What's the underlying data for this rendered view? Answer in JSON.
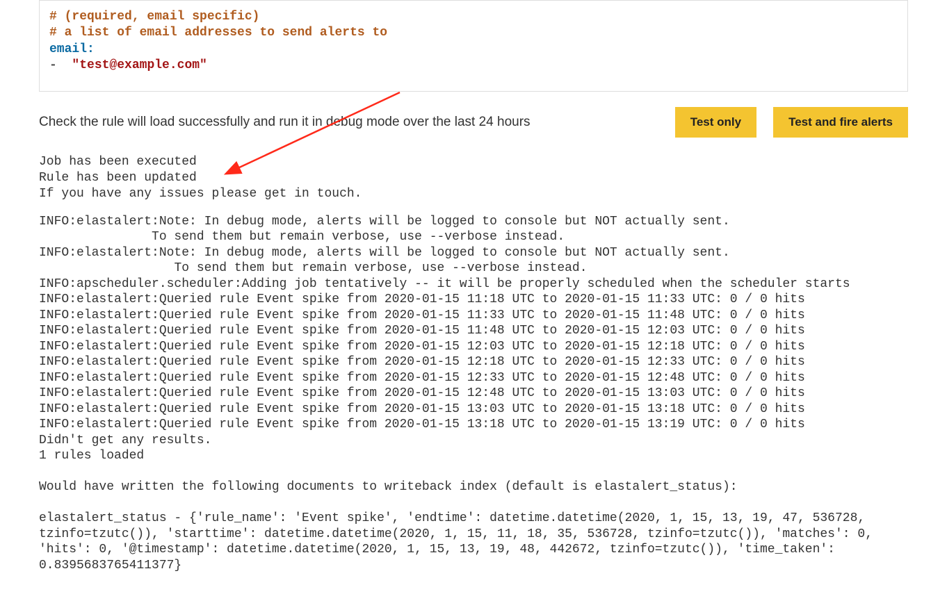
{
  "code": {
    "comment1": "# (required, email specific)",
    "comment2": "# a list of email addresses to send alerts to",
    "key": "email:",
    "dash": "-",
    "value": "\"test@example.com\""
  },
  "instruction": "Check the rule will load successfully and run it in debug mode over the last 24 hours",
  "buttons": {
    "test_only": "Test only",
    "test_fire": "Test and fire alerts"
  },
  "status": {
    "l1": "Job has been executed",
    "l2": "Rule has been updated",
    "l3": "If you have any issues please get in touch."
  },
  "log": "INFO:elastalert:Note: In debug mode, alerts will be logged to console but NOT actually sent.\n               To send them but remain verbose, use --verbose instead.\nINFO:elastalert:Note: In debug mode, alerts will be logged to console but NOT actually sent.\n                  To send them but remain verbose, use --verbose instead.\nINFO:apscheduler.scheduler:Adding job tentatively -- it will be properly scheduled when the scheduler starts\nINFO:elastalert:Queried rule Event spike from 2020-01-15 11:18 UTC to 2020-01-15 11:33 UTC: 0 / 0 hits\nINFO:elastalert:Queried rule Event spike from 2020-01-15 11:33 UTC to 2020-01-15 11:48 UTC: 0 / 0 hits\nINFO:elastalert:Queried rule Event spike from 2020-01-15 11:48 UTC to 2020-01-15 12:03 UTC: 0 / 0 hits\nINFO:elastalert:Queried rule Event spike from 2020-01-15 12:03 UTC to 2020-01-15 12:18 UTC: 0 / 0 hits\nINFO:elastalert:Queried rule Event spike from 2020-01-15 12:18 UTC to 2020-01-15 12:33 UTC: 0 / 0 hits\nINFO:elastalert:Queried rule Event spike from 2020-01-15 12:33 UTC to 2020-01-15 12:48 UTC: 0 / 0 hits\nINFO:elastalert:Queried rule Event spike from 2020-01-15 12:48 UTC to 2020-01-15 13:03 UTC: 0 / 0 hits\nINFO:elastalert:Queried rule Event spike from 2020-01-15 13:03 UTC to 2020-01-15 13:18 UTC: 0 / 0 hits\nINFO:elastalert:Queried rule Event spike from 2020-01-15 13:18 UTC to 2020-01-15 13:19 UTC: 0 / 0 hits\nDidn't get any results.\n1 rules loaded\n\nWould have written the following documents to writeback index (default is elastalert_status):\n\nelastalert_status - {'rule_name': 'Event spike', 'endtime': datetime.datetime(2020, 1, 15, 13, 19, 47, 536728, tzinfo=tzutc()), 'starttime': datetime.datetime(2020, 1, 15, 11, 18, 35, 536728, tzinfo=tzutc()), 'matches': 0, 'hits': 0, '@timestamp': datetime.datetime(2020, 1, 15, 13, 19, 48, 442672, tzinfo=tzutc()), 'time_taken': 0.8395683765411377}"
}
